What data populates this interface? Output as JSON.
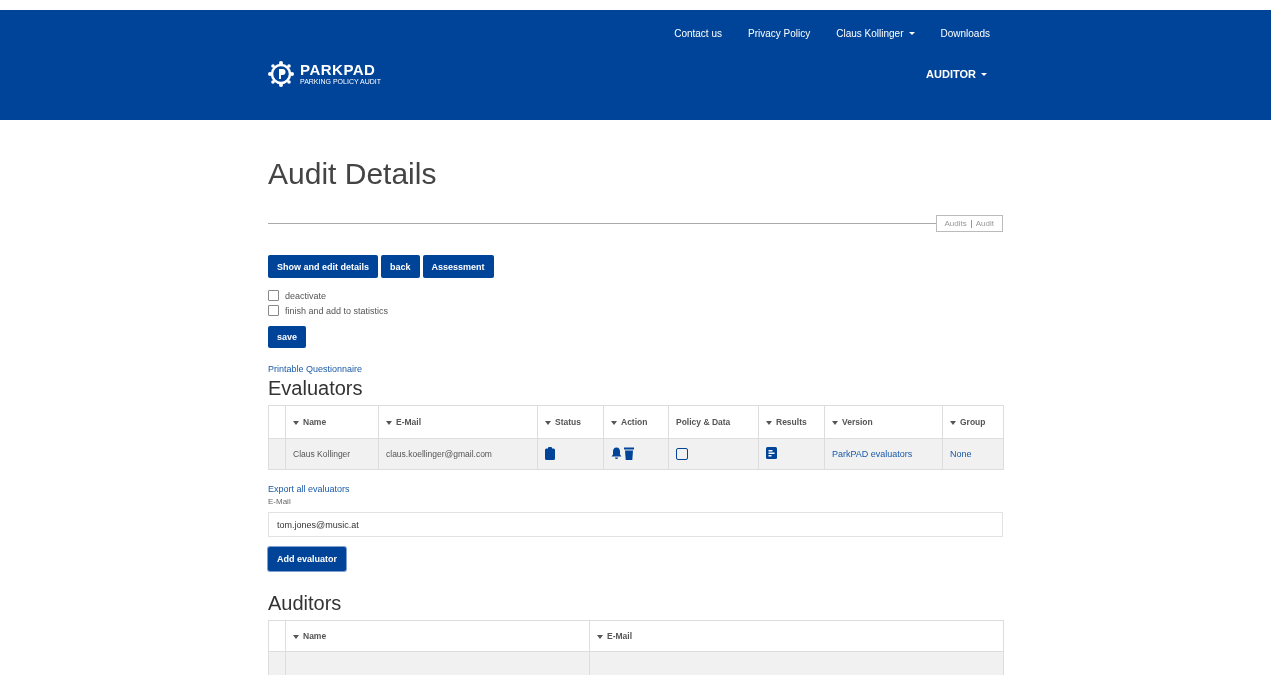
{
  "header": {
    "top_links": [
      {
        "label": "Contact us",
        "dropdown": false
      },
      {
        "label": "Privacy Policy",
        "dropdown": false
      },
      {
        "label": "Claus Kollinger",
        "dropdown": true
      },
      {
        "label": "Downloads",
        "dropdown": false
      }
    ],
    "brand": {
      "name": "PARKPAD",
      "tagline": "PARKING POLICY AUDIT"
    },
    "role_menu": {
      "label": "AUDITOR",
      "dropdown": true
    }
  },
  "page_title": "Audit Details",
  "breadcrumb": [
    "Audits",
    "Audit"
  ],
  "action_buttons": [
    "Show and edit details",
    "back",
    "Assessment"
  ],
  "checkboxes": [
    {
      "label": "deactivate",
      "checked": false
    },
    {
      "label": "finish and add to statistics",
      "checked": false
    }
  ],
  "save_button": "save",
  "printable_link": "Printable Questionnaire",
  "evaluators": {
    "title": "Evaluators",
    "columns": [
      {
        "label": "Name",
        "sortable": true
      },
      {
        "label": "E-Mail",
        "sortable": true
      },
      {
        "label": "Status",
        "sortable": true
      },
      {
        "label": "Action",
        "sortable": true
      },
      {
        "label": "Policy & Data",
        "sortable": false
      },
      {
        "label": "Results",
        "sortable": true
      },
      {
        "label": "Version",
        "sortable": true
      },
      {
        "label": "Group",
        "sortable": true
      }
    ],
    "rows": [
      {
        "name": "Claus Kollinger",
        "email": "claus.koellinger@gmail.com",
        "policy_checked": false,
        "version": "ParkPAD evaluators",
        "group": "None"
      }
    ]
  },
  "export_link": "Export all evaluators",
  "email_field": {
    "label": "E-Mail",
    "value": "tom.jones@music.at"
  },
  "add_button": "Add evaluator",
  "auditors": {
    "title": "Auditors",
    "columns": [
      {
        "label": "Name",
        "sortable": true
      },
      {
        "label": "E-Mail",
        "sortable": true
      }
    ]
  }
}
